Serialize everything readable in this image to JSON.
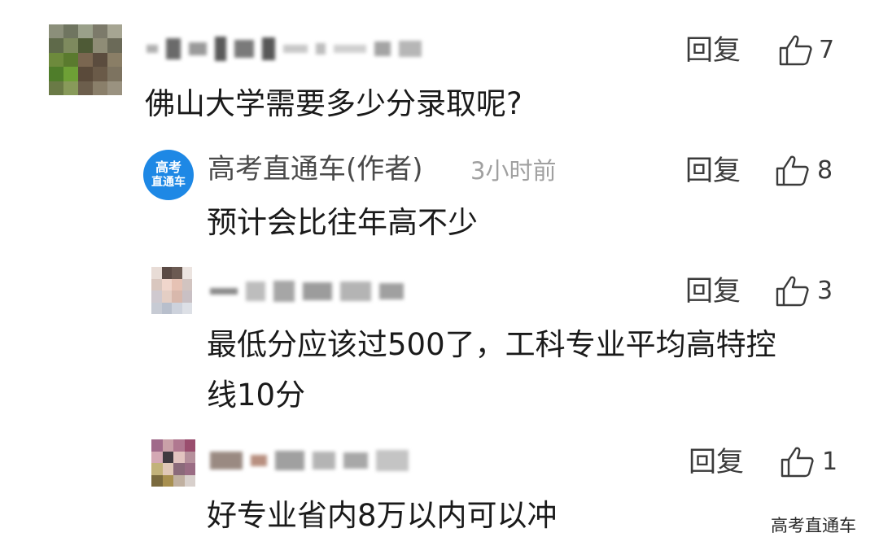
{
  "comments": [
    {
      "name_display": "",
      "text": "佛山大学需要多少分录取呢?",
      "reply_label": "回复",
      "likes": "7"
    },
    {
      "author_name": "高考直通车(作者)",
      "time": "3小时前",
      "avatar_text_line1": "高考",
      "avatar_text_line2": "直通车",
      "text": "预计会比往年高不少",
      "reply_label": "回复",
      "likes": "8"
    },
    {
      "text_line1": "最低分应该过500了，工科专业平均高特控",
      "text_line2": "线10分",
      "reply_label": "回复",
      "likes": "3"
    },
    {
      "text": "好专业省内8万以内可以冲",
      "reply_label": "回复",
      "likes": "1"
    }
  ],
  "watermark": "高考直通车",
  "colors": {
    "author_avatar": "#1e88e5",
    "primary_text": "#1a1a1a",
    "secondary_text": "#3b3b3b",
    "time_text": "#a0a0a0"
  },
  "icons": [
    "thumbs-up-icon"
  ]
}
